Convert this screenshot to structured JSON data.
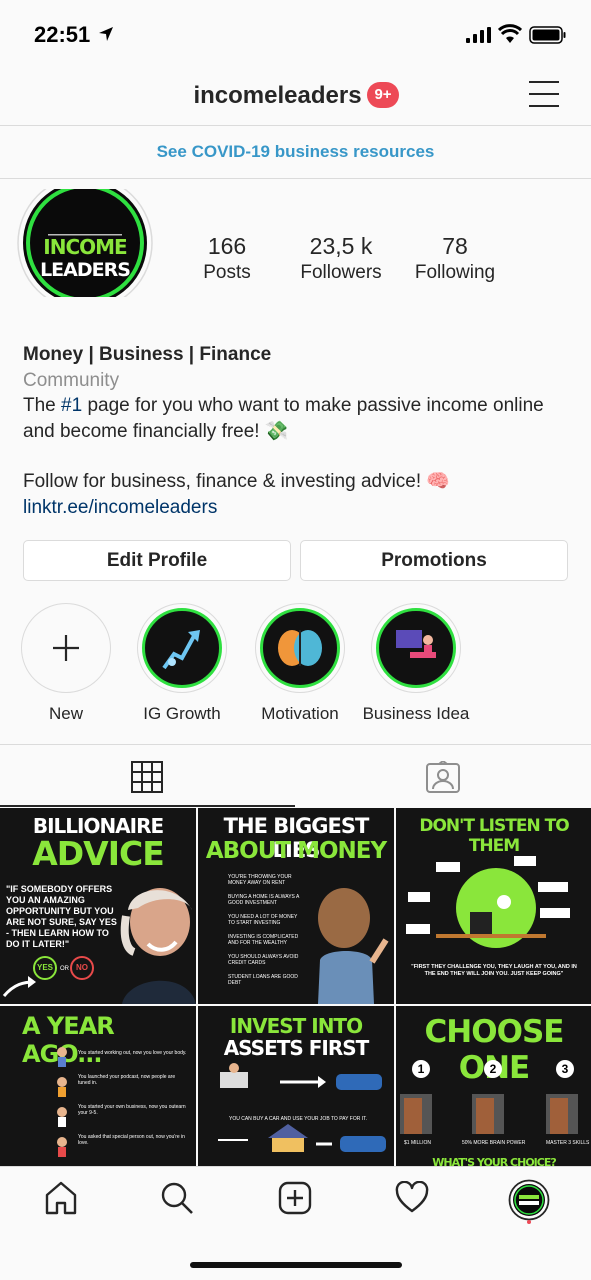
{
  "status_bar": {
    "time": "22:51"
  },
  "header": {
    "username": "incomeleaders",
    "notif_badge": "9+"
  },
  "banner": {
    "text": "See COVID-19 business resources"
  },
  "profile": {
    "avatar_text_line1": "INCOME",
    "avatar_text_line2": "LEADERS",
    "stats": [
      {
        "value": "166",
        "label": "Posts"
      },
      {
        "value": "23,5 k",
        "label": "Followers"
      },
      {
        "value": "78",
        "label": "Following"
      }
    ],
    "name": "Money | Business | Finance",
    "category": "Community",
    "bio_pre": "The ",
    "bio_hashtag": "#1",
    "bio_line1_rest": " page for you who want to make passive income online and become financially free! 💸",
    "bio_line2": "Follow for business, finance & investing advice! 🧠",
    "link": "linktr.ee/incomeleaders"
  },
  "buttons": {
    "edit_profile": "Edit Profile",
    "promotions": "Promotions"
  },
  "highlights": [
    {
      "label": "New"
    },
    {
      "label": "IG Growth"
    },
    {
      "label": "Motivation"
    },
    {
      "label": "Business Idea"
    }
  ],
  "posts": [
    {
      "title1": "BILLIONAIRE",
      "title2": "ADVICE",
      "quote": "\"IF SOMEBODY OFFERS YOU AN AMAZING OPPORTUNITY BUT YOU ARE NOT SURE, SAY YES - THEN LEARN HOW TO DO IT LATER!\"",
      "yes": "YES",
      "no": "NO",
      "or": "OR"
    },
    {
      "title1": "THE BIGGEST LIES",
      "title2": "ABOUT MONEY",
      "items": [
        "YOU'RE THROWING YOUR MONEY AWAY ON RENT",
        "BUYING A HOME IS ALWAYS A GOOD INVESTMENT",
        "YOU NEED A LOT OF MONEY TO START INVESTING",
        "INVESTING IS COMPLICATED AND FOR THE WEALTHY",
        "YOU SHOULD ALWAYS AVOID CREDIT CARDS",
        "STUDENT LOANS ARE GOOD DEBT"
      ]
    },
    {
      "title1": "DON'T LISTEN TO THEM",
      "caption": "\"FIRST THEY CHALLENGE YOU, THEY LAUGH AT YOU, AND IN THE END THEY WILL JOIN YOU. JUST KEEP GOING\""
    },
    {
      "title1": "A YEAR AGO...",
      "items": [
        "You started working out, now you love your body.",
        "You launched your podcast, now people are tuned in.",
        "You started your own business, now you outearn your 9-5.",
        "You asked that special person out, now you're in love."
      ]
    },
    {
      "title1": "INVEST INTO",
      "title2": "ASSETS FIRST",
      "caption": "YOU CAN BUY A CAR AND USE YOUR JOB TO PAY FOR IT."
    },
    {
      "title1": "CHOOSE ONE",
      "options": [
        "1",
        "2",
        "3"
      ],
      "labels": [
        "$1 MILLION",
        "50% MORE BRAIN POWER",
        "MASTER 3 SKILLS"
      ],
      "footer": "WHAT'S YOUR CHOICE?"
    }
  ],
  "colors": {
    "accent_green": "#8ae63b",
    "link_blue": "#003569",
    "banner_blue": "#3897c8",
    "badge_red": "#ed4956"
  },
  "nav": [
    "home-icon",
    "search-icon",
    "add-post-icon",
    "heart-icon",
    "profile-avatar"
  ]
}
